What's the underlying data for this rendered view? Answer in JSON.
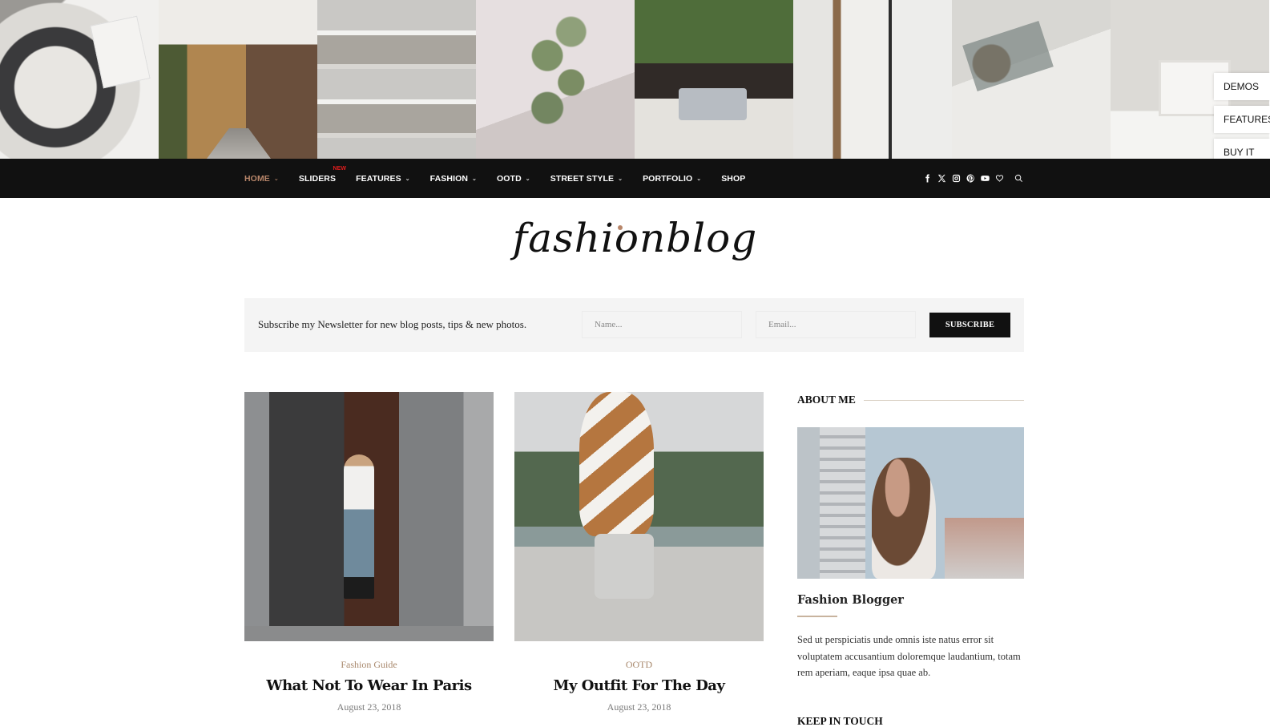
{
  "instagram": {
    "tiles": [
      {
        "name": "coffee-tray-photo"
      },
      {
        "name": "london-mews-photo"
      },
      {
        "name": "bookshelf-photo"
      },
      {
        "name": "paint-swatches-photo"
      },
      {
        "name": "garden-patio-photo"
      },
      {
        "name": "hallway-stairs-photo"
      },
      {
        "name": "lint-roller-photo"
      },
      {
        "name": "bedside-plant-photo"
      }
    ]
  },
  "side_buttons": [
    "DEMOS",
    "FEATURES",
    "BUY IT"
  ],
  "nav": {
    "items": [
      {
        "label": "HOME",
        "active": true,
        "dropdown": true
      },
      {
        "label": "SLIDERS",
        "badge": "NEW",
        "dropdown": false
      },
      {
        "label": "FEATURES",
        "dropdown": true
      },
      {
        "label": "FASHION",
        "dropdown": true
      },
      {
        "label": "OOTD",
        "dropdown": true
      },
      {
        "label": "STREET STYLE",
        "dropdown": true
      },
      {
        "label": "PORTFOLIO",
        "dropdown": true
      },
      {
        "label": "SHOP",
        "dropdown": false
      }
    ],
    "chevron": "⌄",
    "social_icons": [
      "facebook-icon",
      "x-twitter-icon",
      "instagram-icon",
      "pinterest-icon",
      "youtube-icon",
      "heart-icon",
      "search-icon"
    ],
    "accent_color": "#b8866a"
  },
  "logo": {
    "text": "fashionblog"
  },
  "newsletter": {
    "text": "Subscribe my Newsletter for new blog posts, tips & new photos.",
    "name_placeholder": "Name...",
    "email_placeholder": "Email...",
    "button_label": "SUBSCRIBE"
  },
  "posts": [
    {
      "category": "Fashion Guide",
      "title": "What Not To Wear In Paris",
      "date": "August 23, 2018"
    },
    {
      "category": "OOTD",
      "title": "My Outfit For The Day",
      "date": "August 23, 2018"
    }
  ],
  "sidebar": {
    "about": {
      "heading": "ABOUT ME",
      "name": "Fashion Blogger",
      "text": "Sed ut perspiciatis unde omnis iste natus error sit voluptatem accusantium doloremque laudantium, totam rem aperiam, eaque ipsa quae ab."
    },
    "next_heading": "KEEP IN TOUCH"
  }
}
